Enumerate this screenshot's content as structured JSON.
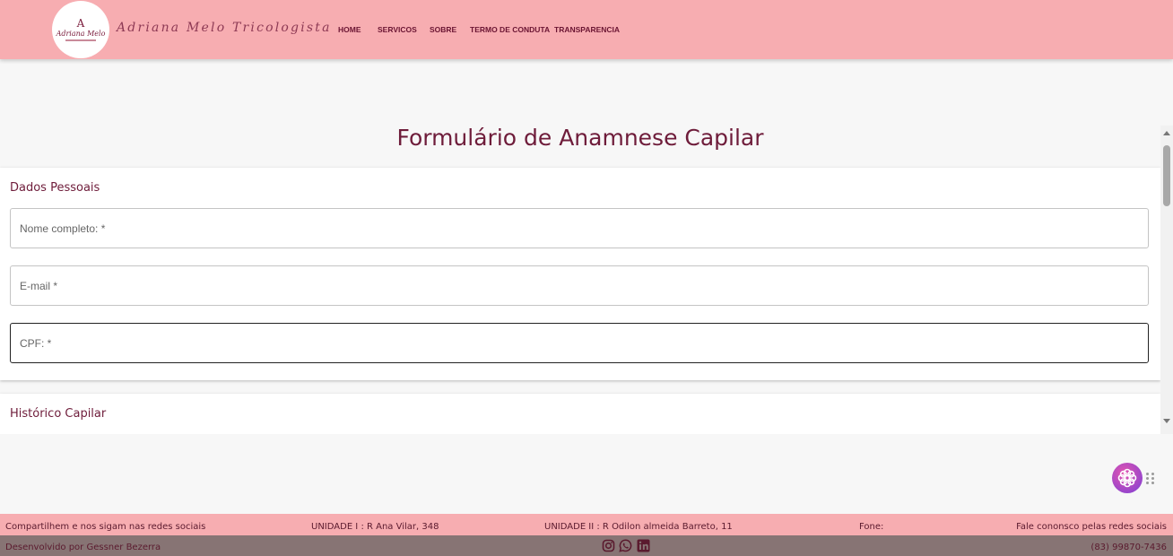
{
  "header": {
    "logo_mark": "A",
    "logo_name": "Adriana Melo",
    "brand_text": "Adriana Melo Tricologista",
    "nav": {
      "home": "HOME",
      "services": "SERVICOS",
      "about": "SOBRE",
      "conduct": "TERMO DE CONDUTA",
      "transparency": "TRANSPARENCIA"
    }
  },
  "page": {
    "title": "Formulário de Anamnese Capilar"
  },
  "form": {
    "personal": {
      "title": "Dados Pessoais",
      "name_placeholder": "Nome completo: *",
      "email_placeholder": "E-mail *",
      "cpf_placeholder": "CPF: *"
    },
    "history": {
      "title": "Histórico Capilar"
    }
  },
  "footer": {
    "share": "Compartilhem e nos sigam nas redes sociais",
    "unit1": "UNIDADE I : R Ana Vilar, 348",
    "unit2": "UNIDADE II : R Odilon almeida Barreto, 11",
    "phone_label": "Fone:",
    "contact": "Fale cononsco pelas redes sociais",
    "developer": "Desenvolvido por Gessner Bezerra",
    "phone": "(83) 99870-7436"
  },
  "icons": {
    "social": [
      "instagram-icon",
      "whatsapp-icon",
      "linkedin-icon"
    ],
    "widget": "flower-icon"
  },
  "colors": {
    "header_bg": "#f7adb1",
    "accent": "#6e1c3a",
    "footer_dark": "#877474"
  }
}
